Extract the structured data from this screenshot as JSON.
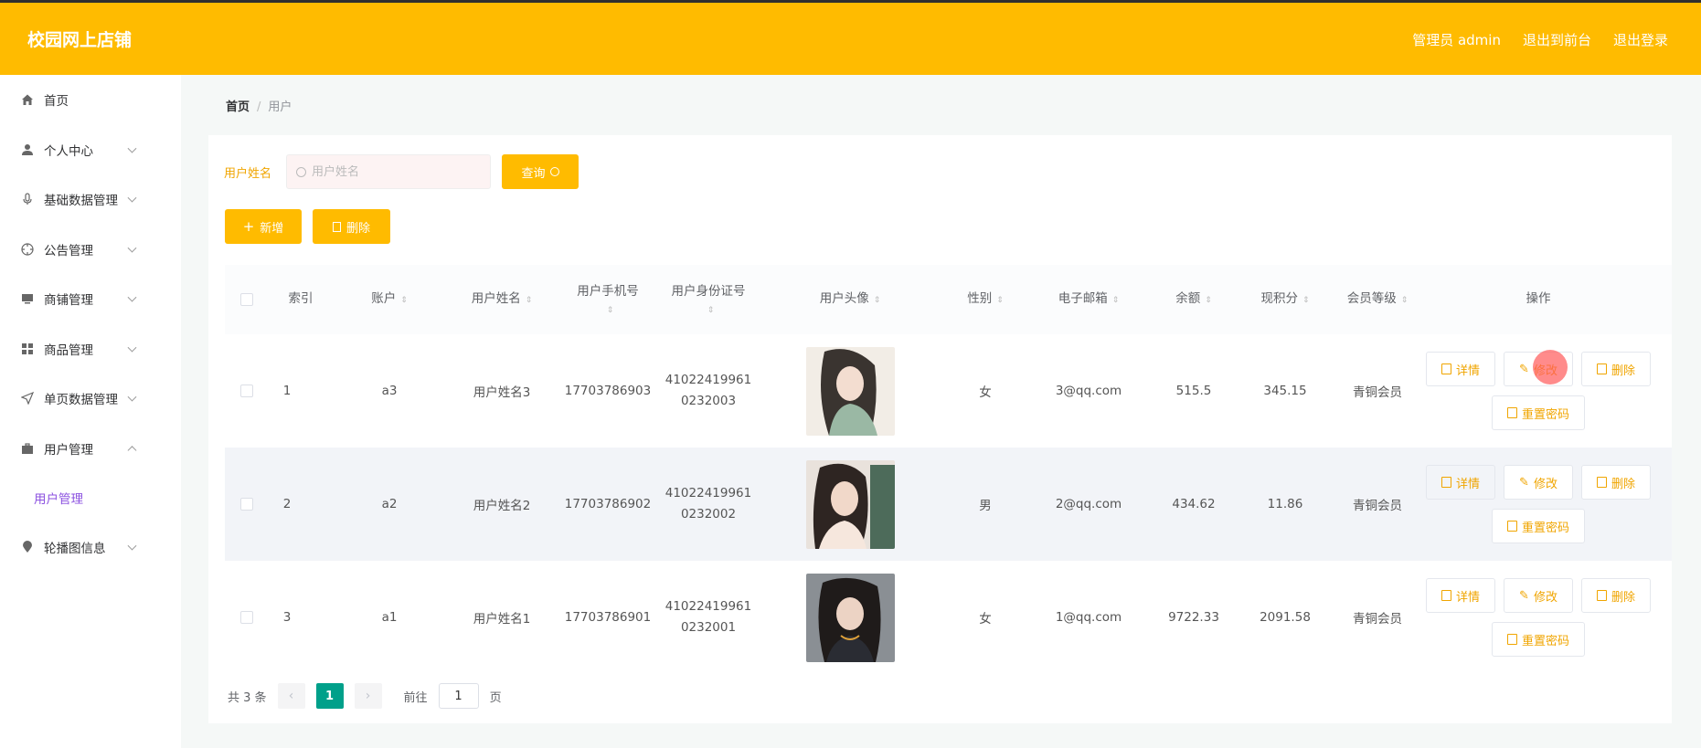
{
  "header": {
    "brand": "校园网上店铺",
    "links": [
      "管理员 admin",
      "退出到前台",
      "退出登录"
    ]
  },
  "sidebar": {
    "items": [
      {
        "label": "首页",
        "icon": "home-icon"
      },
      {
        "label": "个人中心",
        "icon": "user-icon"
      },
      {
        "label": "基础数据管理",
        "icon": "microphone-icon"
      },
      {
        "label": "公告管理",
        "icon": "compass-icon"
      },
      {
        "label": "商铺管理",
        "icon": "monitor-icon"
      },
      {
        "label": "商品管理",
        "icon": "grid-icon"
      },
      {
        "label": "单页数据管理",
        "icon": "send-icon"
      },
      {
        "label": "用户管理",
        "icon": "suitcase-icon"
      }
    ],
    "active_sub": "用户管理",
    "last_item": {
      "label": "轮播图信息",
      "icon": "location-icon"
    }
  },
  "breadcrumb": {
    "home": "首页",
    "current": "用户"
  },
  "search": {
    "label": "用户姓名",
    "placeholder": "用户姓名",
    "query_button": "查询"
  },
  "actions": {
    "add": "新增",
    "delete": "删除"
  },
  "table": {
    "columns": [
      "索引",
      "账户",
      "用户姓名",
      "用户手机号",
      "用户身份证号",
      "用户头像",
      "性别",
      "电子邮箱",
      "余额",
      "现积分",
      "会员等级",
      "操作"
    ],
    "rows": [
      {
        "index": "1",
        "account": "a3",
        "name": "用户姓名3",
        "phone": "17703786903",
        "id_line1": "41022419961",
        "id_line2": "0232003",
        "gender": "女",
        "email": "3@qq.com",
        "balance": "515.5",
        "points": "345.15",
        "level": "青铜会员"
      },
      {
        "index": "2",
        "account": "a2",
        "name": "用户姓名2",
        "phone": "17703786902",
        "id_line1": "41022419961",
        "id_line2": "0232002",
        "gender": "男",
        "email": "2@qq.com",
        "balance": "434.62",
        "points": "11.86",
        "level": "青铜会员"
      },
      {
        "index": "3",
        "account": "a1",
        "name": "用户姓名1",
        "phone": "17703786901",
        "id_line1": "41022419961",
        "id_line2": "0232001",
        "gender": "女",
        "email": "1@qq.com",
        "balance": "9722.33",
        "points": "2091.58",
        "level": "青铜会员"
      }
    ],
    "op_labels": {
      "detail": "详情",
      "edit": "修改",
      "delete": "删除",
      "reset": "重置密码"
    }
  },
  "pagination": {
    "total": "共 3 条",
    "current_page": "1",
    "goto_label": "前往",
    "goto_value": "1",
    "page_unit": "页"
  },
  "colors": {
    "brand": "#ffbb00",
    "accent_text": "#f0a500",
    "pager_active": "#00a08a",
    "active_menu": "#8c52e0"
  }
}
